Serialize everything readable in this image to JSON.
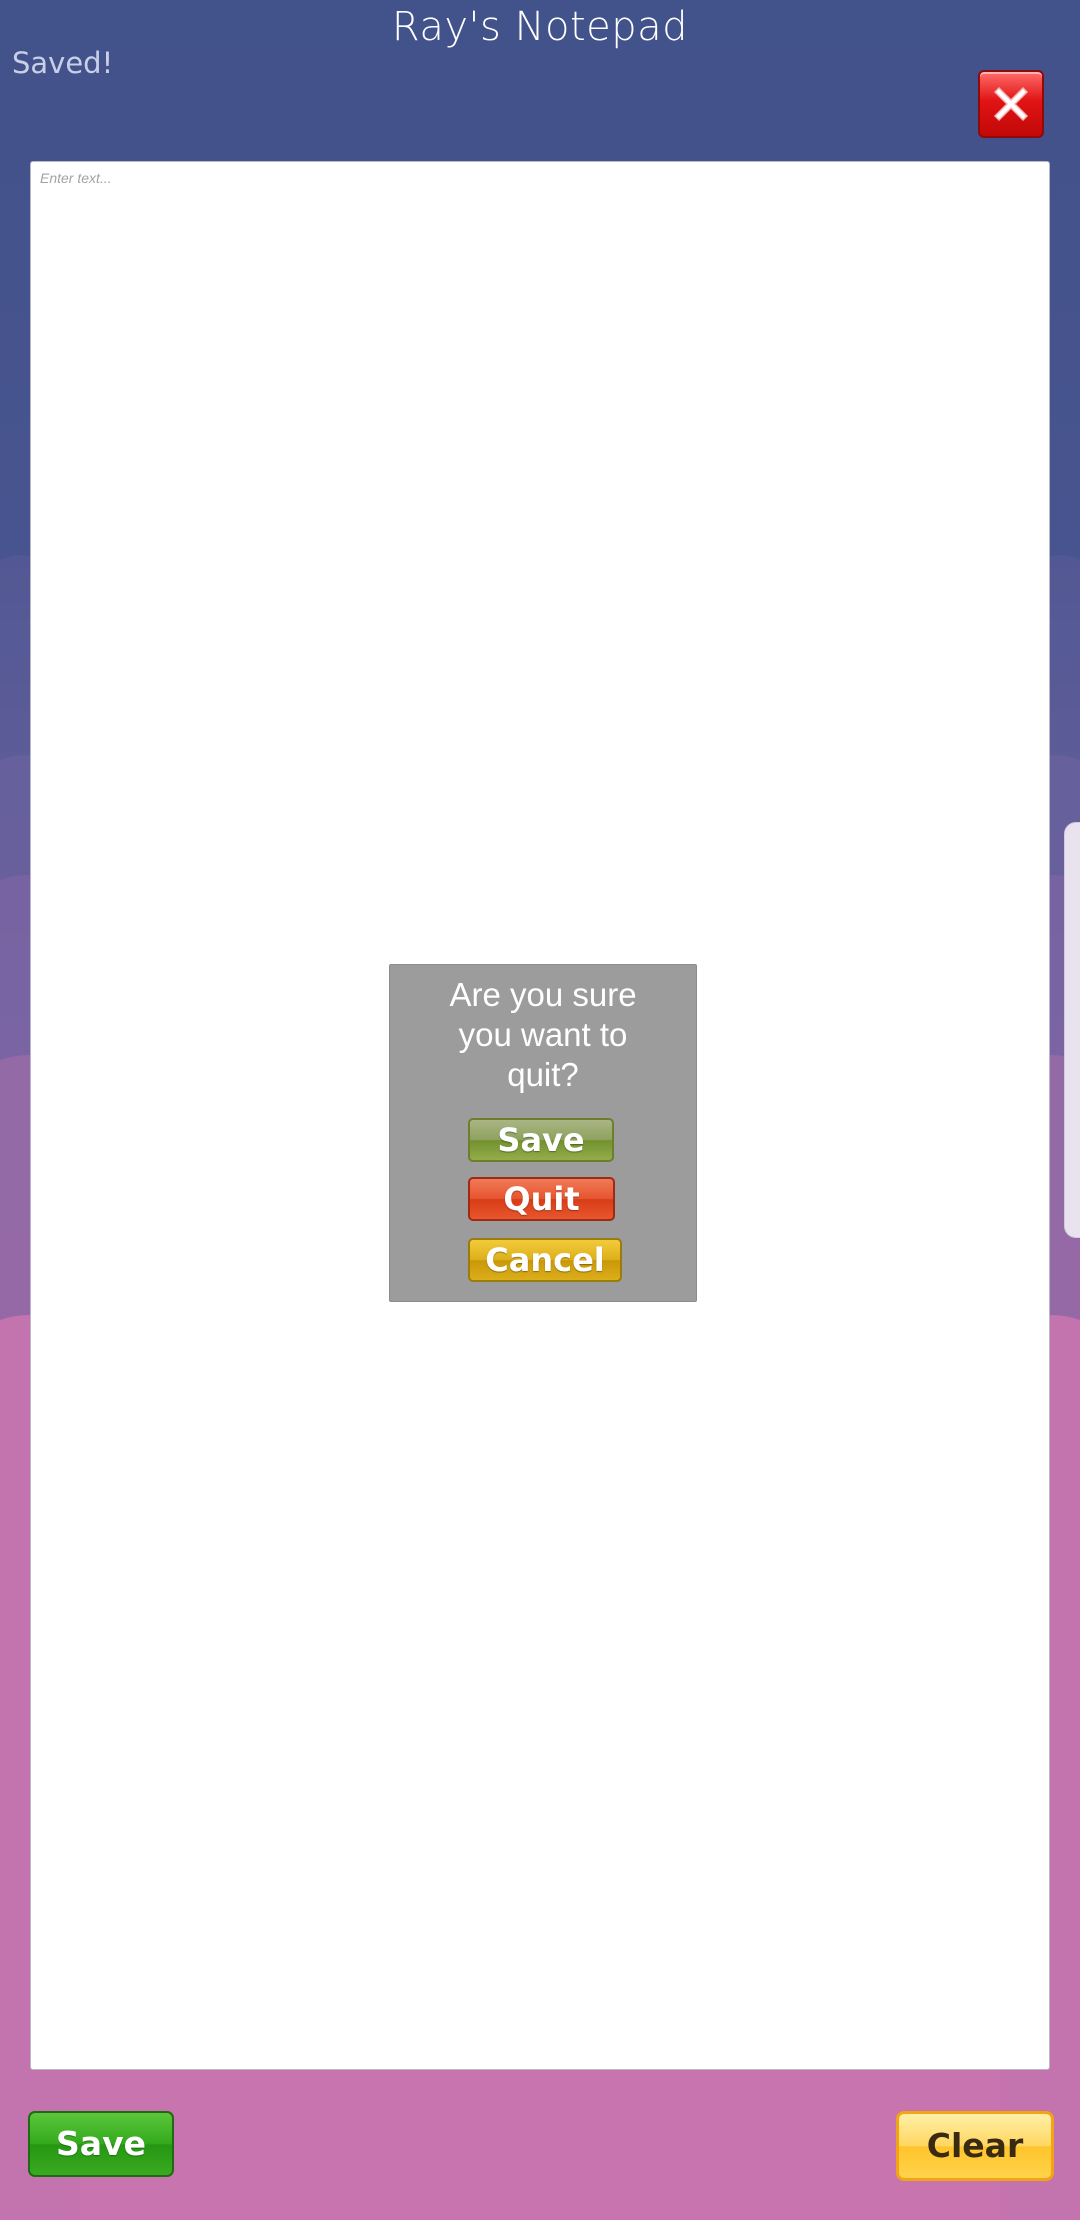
{
  "app": {
    "title": "Ray's Notepad",
    "status": "Saved!"
  },
  "editor": {
    "placeholder": "Enter text...",
    "value": ""
  },
  "dialog": {
    "message": "Are you sure you want to quit?",
    "save_label": "Save",
    "quit_label": "Quit",
    "cancel_label": "Cancel"
  },
  "footer": {
    "save_label": "Save",
    "clear_label": "Clear"
  },
  "icons": {
    "close": "close-icon"
  },
  "colors": {
    "top_background": "#43538b",
    "bottom_background": "#c874ae",
    "dialog_background": "#9c9c9c",
    "save_green": "#34a91c",
    "quit_red": "#e6532e",
    "cancel_yellow": "#ddb01a",
    "clear_yellow": "#ffd660",
    "close_red": "#e11414"
  }
}
